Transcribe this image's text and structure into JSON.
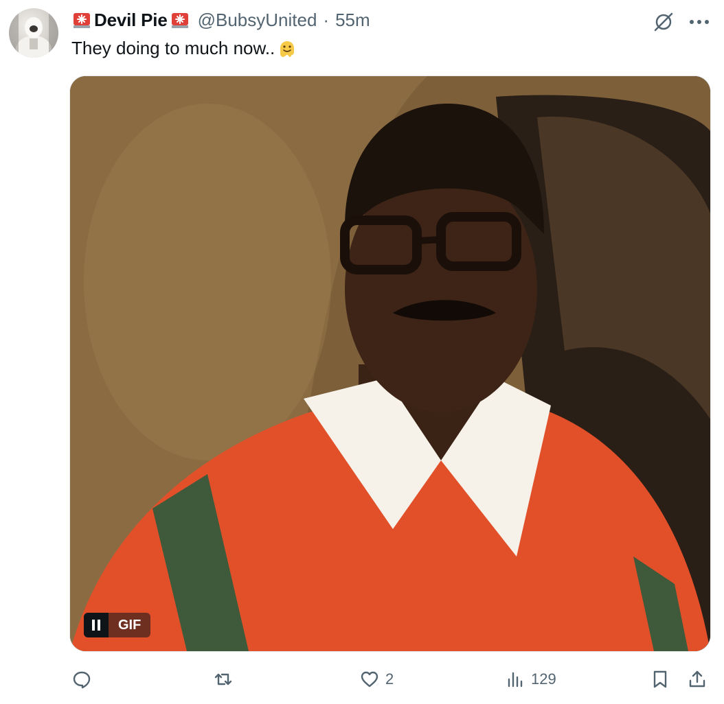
{
  "tweet": {
    "display_name": "Devil Pie",
    "handle": "@BubsyUnited",
    "separator": "·",
    "timestamp": "55m",
    "text": "They doing to much now..",
    "media": {
      "badge_label": "GIF"
    },
    "actions": {
      "reply_count": "",
      "retweet_count": "",
      "like_count": "2",
      "views_count": "129"
    }
  },
  "icons": [
    "siren-emoji",
    "grok-icon",
    "more-icon",
    "melting-face-emoji",
    "pause-icon",
    "reply-icon",
    "retweet-icon",
    "like-icon",
    "views-icon",
    "bookmark-icon",
    "share-icon"
  ],
  "colors": {
    "text_primary": "#0f1419",
    "text_secondary": "#536471",
    "background": "#ffffff"
  }
}
